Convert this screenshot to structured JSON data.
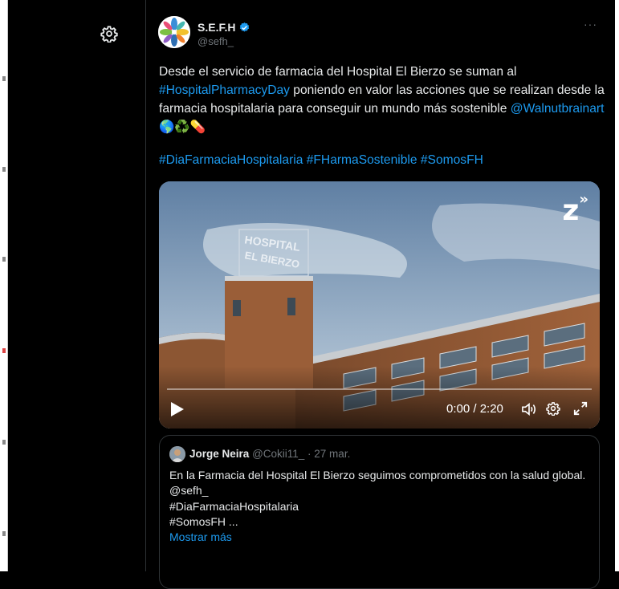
{
  "tweet": {
    "display_name": "S.E.F.H",
    "handle": "@sefh_",
    "more_label": "···",
    "text_part1": "Desde el servicio de farmacia del Hospital El Bierzo se suman al",
    "text_link1": "#HospitalPharmacyDay",
    "text_part2": " poniendo en valor las acciones que se realizan desde la farmacia hospitalaria para conseguir un mundo más sostenible",
    "text_mention": "@Walnutbrainart",
    "emojis": "🌎♻️💊",
    "hashtags": "#DiaFarmaciaHospitalaria #FHarmaSostenible #SomosFH"
  },
  "video": {
    "logo": "z",
    "time": "0:00 / 2:20",
    "progress": 0,
    "building_sign_lines": [
      "HOSPITAL",
      "EL BIERZO"
    ]
  },
  "quote": {
    "name": "Jorge Neira",
    "meta": "@Cokii11_ · 27 mar.",
    "lines": [
      "En la Farmacia del Hospital El Bierzo seguimos comprometidos con la salud global.",
      "@sefh_",
      "#DiaFarmaciaHospitalaria",
      "#SomosFH ..."
    ],
    "show_more": "Mostrar más"
  },
  "colors": {
    "background": "#000000",
    "link": "#1d9bf0",
    "muted": "#71767b",
    "text": "#e7e9ea",
    "verified": "#1d9bf0"
  },
  "icons": [
    "settings-icon",
    "verified-badge-icon",
    "more-icon",
    "play-icon",
    "volume-icon",
    "video-settings-icon",
    "fullscreen-icon"
  ]
}
